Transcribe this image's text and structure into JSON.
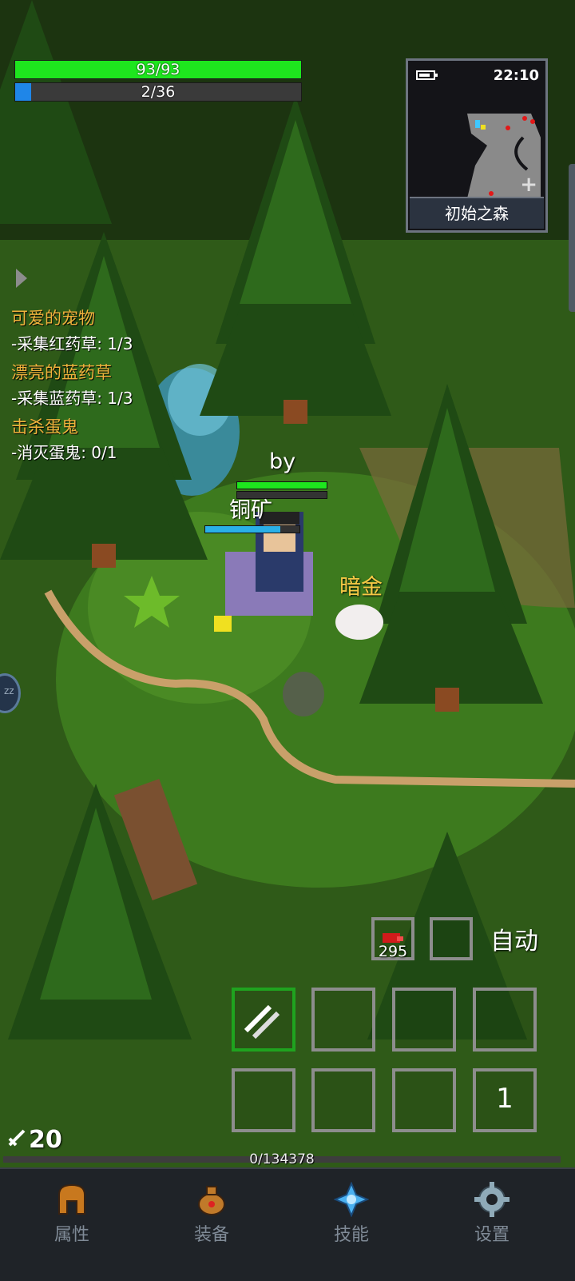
{
  "hud": {
    "hp": {
      "current": 93,
      "max": 93,
      "text": "93/93",
      "color": "#1ee61e"
    },
    "mp": {
      "current": 2,
      "max": 36,
      "text": "2/36",
      "color": "#1f86e8"
    }
  },
  "minimap": {
    "time": "22:10",
    "battery_level": 0.8,
    "area_name": "初始之森",
    "battery_icon": "battery-icon",
    "zoom_icon": "plus-icon"
  },
  "quests": [
    {
      "title": "可爱的宠物",
      "step": "-采集红药草: 1/3"
    },
    {
      "title": "漂亮的蓝药草",
      "step": "-采集蓝药草: 1/3"
    },
    {
      "title": "击杀蛋鬼",
      "step": "-消灭蛋鬼: 0/1"
    }
  ],
  "characters": {
    "player_name": "by",
    "player_hp": 1.0,
    "pet_name": "铜矿",
    "pet_mp": 0.8,
    "rabbit_name": "暗金"
  },
  "quickbar": {
    "potion_count": "295",
    "auto_label": "自动",
    "page_number": "1"
  },
  "status": {
    "attack_value": "20",
    "exp_text": "0/134378",
    "exp_progress": 0.0
  },
  "nav": [
    {
      "label": "属性",
      "icon": "helmet-icon"
    },
    {
      "label": "装备",
      "icon": "bag-icon"
    },
    {
      "label": "技能",
      "icon": "skill-crystal-icon"
    },
    {
      "label": "设置",
      "icon": "gear-icon"
    }
  ],
  "colors": {
    "quest_title": "#f0b23c",
    "rabbit_name": "#f6c945",
    "active_slot": "#1fa31f"
  }
}
